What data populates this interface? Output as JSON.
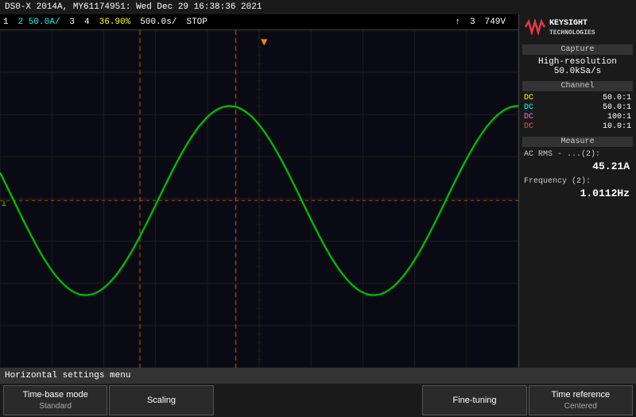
{
  "title": "DS0-X 2014A, MY61174951: Wed Dec 29 16:38:36 2021",
  "status": {
    "ch1": "1",
    "ch2_val": "2  50.0A/",
    "ch3": "3",
    "ch4": "4",
    "timeref": "36.90%",
    "timescale": "500.0s/",
    "stop": "STOP",
    "trigger": "↑",
    "trig_num": "3",
    "voltage": "749V"
  },
  "right_panel": {
    "logo_text": "KEYSIGHT\nTECHNOLOGIES",
    "capture_title": "Capture",
    "capture_mode": "High-resolution",
    "capture_rate": "50.0kSa/s",
    "channel_title": "Channel",
    "channels": [
      {
        "label": "DC",
        "value": "50.0:1",
        "color": "ch1"
      },
      {
        "label": "DC",
        "value": "50.0:1",
        "color": "ch2"
      },
      {
        "label": "DC",
        "value": "100:1",
        "color": "ch3"
      },
      {
        "label": "DC",
        "value": "10.0:1",
        "color": "ch4"
      }
    ],
    "measure_title": "Measure",
    "measure1_label": "AC RMS  - ...(2):",
    "measure1_val": "45.21A",
    "measure2_label": "Frequency (2):",
    "measure2_val": "1.0112Hz"
  },
  "bottom": {
    "menu_label": "Horizontal settings menu",
    "buttons": [
      {
        "top": "Time-base mode",
        "bot": "Standard"
      },
      {
        "top": "Scaling",
        "bot": ""
      },
      {
        "top": "Fine-tuning",
        "bot": ""
      },
      {
        "top": "Time reference",
        "bot": "Centered"
      }
    ]
  },
  "grid": {
    "cols": 10,
    "rows": 8
  }
}
